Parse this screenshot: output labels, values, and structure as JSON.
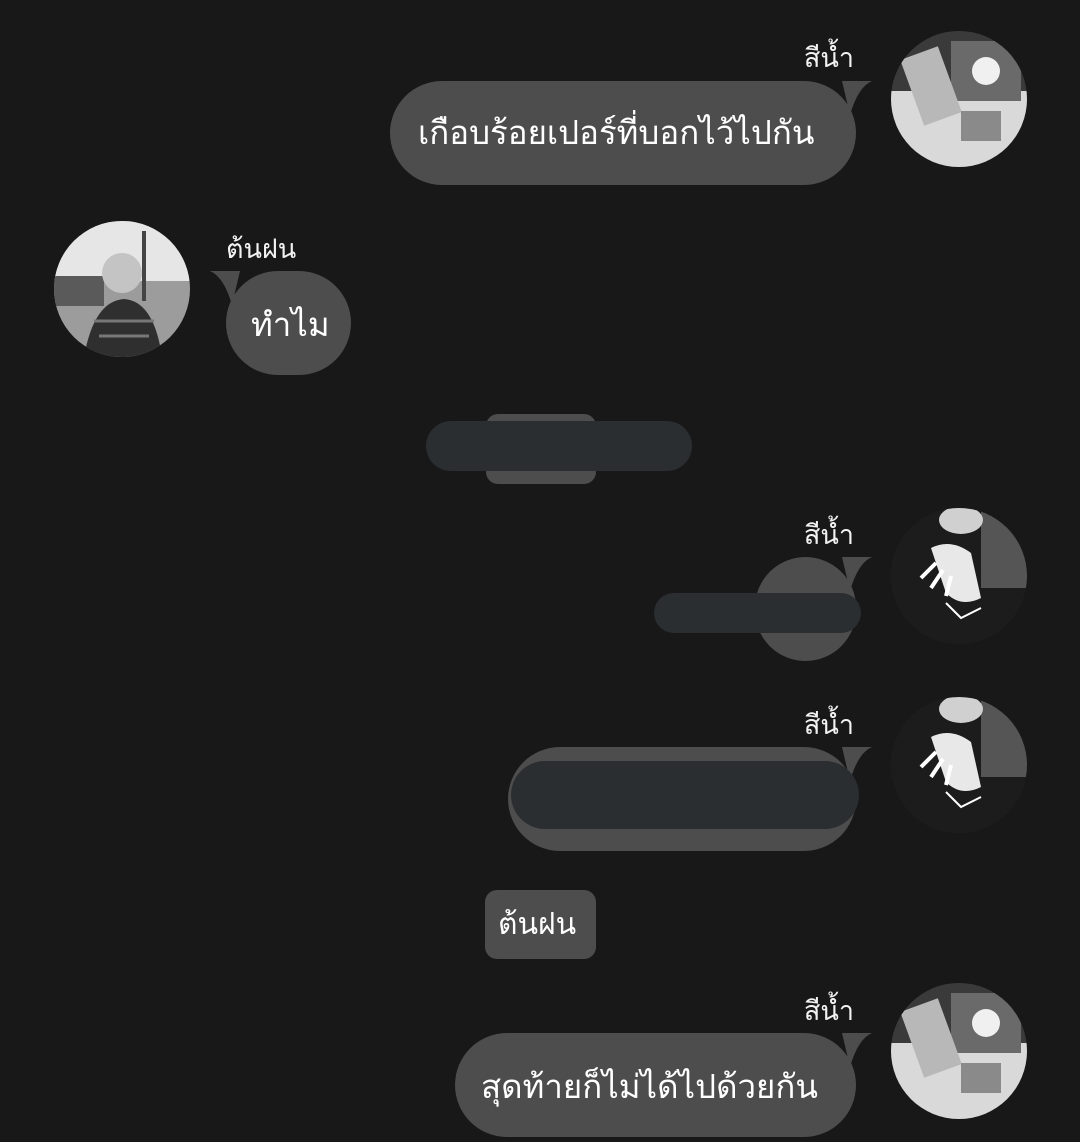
{
  "messages": [
    {
      "sender": "สีน้ำ",
      "text": "เกือบร้อยเปอร์ที่บอกไว้ไปกัน"
    },
    {
      "sender": "ต้นฝน",
      "text": "ทำไม"
    },
    {
      "sender": "สีน้ำ",
      "text": ""
    },
    {
      "sender": "สีน้ำ",
      "text": ""
    },
    {
      "sender": "สีน้ำ",
      "text": "สุดท้ายก็ไม่ได้ไปด้วยกัน"
    }
  ],
  "system_label": "ต้นฝน",
  "colors": {
    "background": "#181818",
    "bubble": "#4d4d4d",
    "redaction": "#2b2e31"
  }
}
